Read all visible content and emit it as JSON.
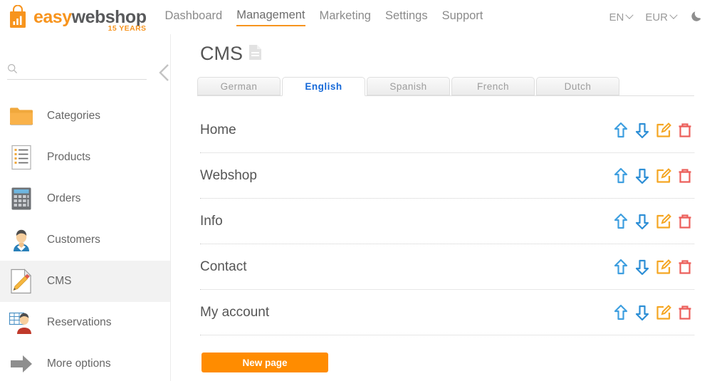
{
  "brand": {
    "logo_easy": "easy",
    "logo_webshop": "webshop",
    "anniversary": "15 YEARS",
    "bag_icon": "shopping-bag-icon"
  },
  "topnav": {
    "items": [
      {
        "label": "Dashboard",
        "active": false
      },
      {
        "label": "Management",
        "active": true
      },
      {
        "label": "Marketing",
        "active": false
      },
      {
        "label": "Settings",
        "active": false
      },
      {
        "label": "Support",
        "active": false
      }
    ],
    "language": "EN",
    "currency": "EUR",
    "theme_icon": "moon-icon"
  },
  "sidebar": {
    "search_placeholder": "",
    "search_value": "",
    "search_icon": "search-icon",
    "collapse_icon": "chevron-left-icon",
    "items": [
      {
        "label": "Categories",
        "icon": "folder-icon",
        "active": false
      },
      {
        "label": "Products",
        "icon": "list-document-icon",
        "active": false
      },
      {
        "label": "Orders",
        "icon": "calculator-icon",
        "active": false
      },
      {
        "label": "Customers",
        "icon": "customer-icon",
        "active": false
      },
      {
        "label": "CMS",
        "icon": "page-pencil-icon",
        "active": true
      },
      {
        "label": "Reservations",
        "icon": "reservation-icon",
        "active": false
      },
      {
        "label": "More options",
        "icon": "arrow-right-icon",
        "active": false
      }
    ]
  },
  "main": {
    "title": "CMS",
    "title_icon": "document-icon",
    "tabs": [
      {
        "label": "German",
        "active": false
      },
      {
        "label": "English",
        "active": true
      },
      {
        "label": "Spanish",
        "active": false
      },
      {
        "label": "French",
        "active": false
      },
      {
        "label": "Dutch",
        "active": false
      }
    ],
    "pages": [
      {
        "name": "Home"
      },
      {
        "name": "Webshop"
      },
      {
        "name": "Info"
      },
      {
        "name": "Contact"
      },
      {
        "name": "My account"
      }
    ],
    "row_actions": [
      {
        "name": "move-up-icon",
        "title": "Move up"
      },
      {
        "name": "move-down-icon",
        "title": "Move down"
      },
      {
        "name": "edit-icon",
        "title": "Edit"
      },
      {
        "name": "delete-icon",
        "title": "Delete"
      }
    ],
    "new_page_label": "New page"
  },
  "colors": {
    "brand_orange": "#f7941e",
    "button_orange": "#ff8c00",
    "active_tab_blue": "#1669d8",
    "arrow_blue": "#3f9fe0",
    "edit_orange": "#f5a623",
    "delete_red": "#ec5f5b",
    "text_gray": "#555555"
  }
}
